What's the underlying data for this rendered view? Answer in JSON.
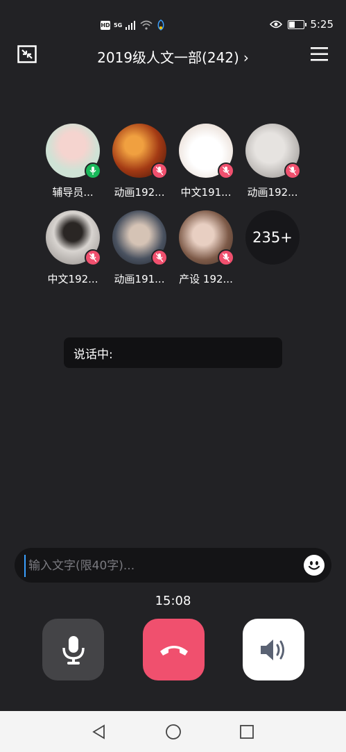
{
  "status_bar": {
    "hd": "HD",
    "network": "5G",
    "time": "5:25",
    "battery_level": 0.45
  },
  "header": {
    "title": "2019级人文一部(242)"
  },
  "members": [
    {
      "name": "辅导员...",
      "mic": "on",
      "avatar_color": "#cfd8c8"
    },
    {
      "name": "动画192...",
      "mic": "off",
      "avatar_color": "#7a2a10"
    },
    {
      "name": "中文191...",
      "mic": "off",
      "avatar_color": "#f3ece6"
    },
    {
      "name": "动画192...",
      "mic": "off",
      "avatar_color": "#bfbcb8"
    },
    {
      "name": "中文192...",
      "mic": "off",
      "avatar_color": "#8a8684"
    },
    {
      "name": "动画191...",
      "mic": "off",
      "avatar_color": "#5a6470"
    },
    {
      "name": "产设 192...",
      "mic": "off",
      "avatar_color": "#a8908a"
    }
  ],
  "more_count": "235+",
  "speaking": {
    "label": "说话中:"
  },
  "input": {
    "placeholder": "输入文字(限40字)..."
  },
  "timer": "15:08",
  "colors": {
    "background": "#222225",
    "hangup": "#f0506e",
    "mic_on": "#19b85a",
    "mic_off": "#f0506e"
  }
}
